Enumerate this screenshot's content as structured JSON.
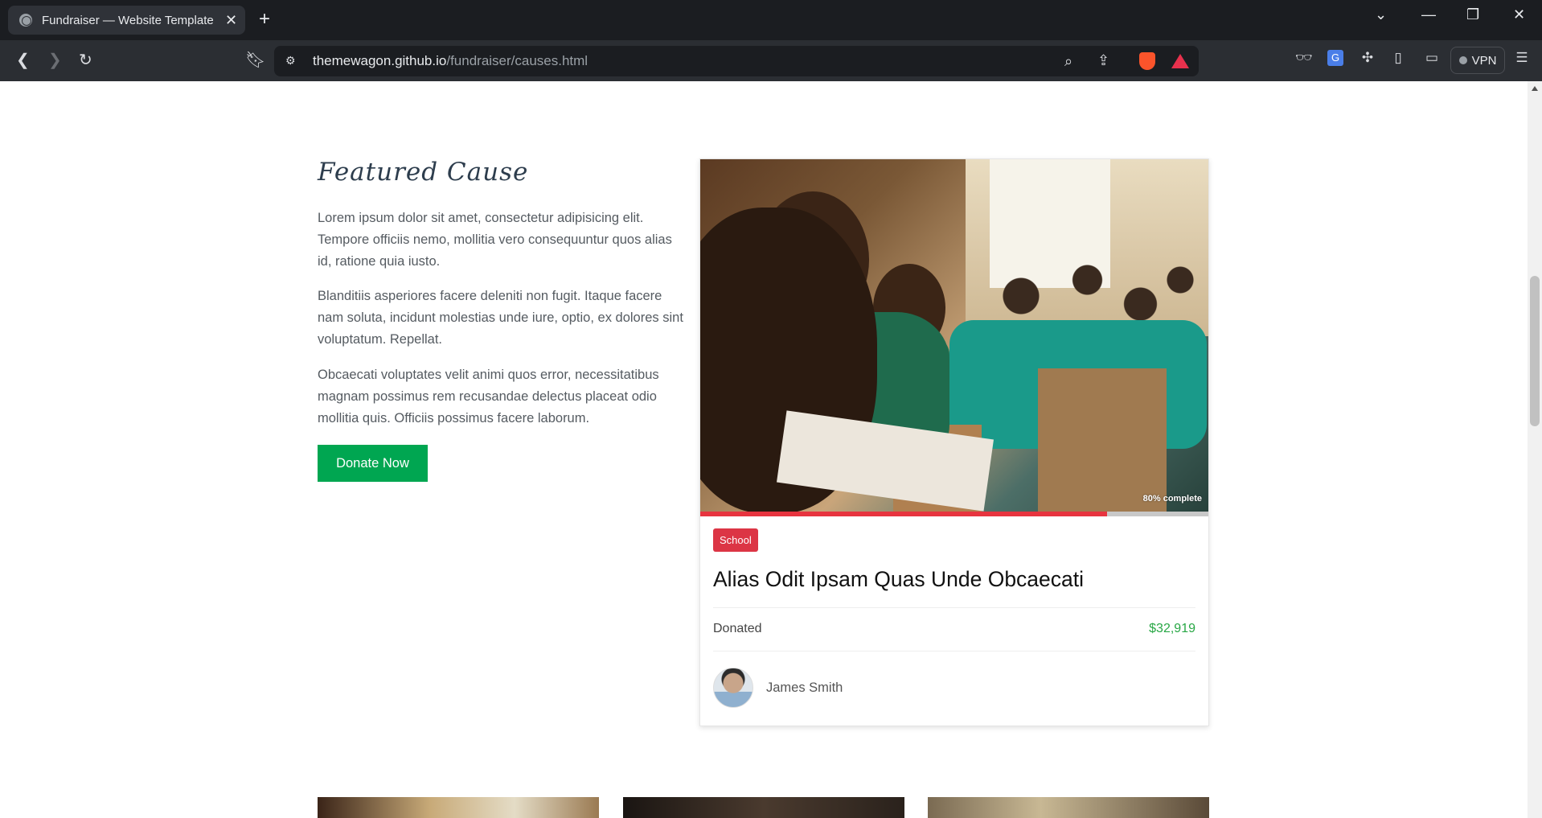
{
  "browser": {
    "tab_title": "Fundraiser — Website Template",
    "url_host": "themewagon.github.io",
    "url_path": "/fundraiser/causes.html",
    "vpn_label": "VPN",
    "new_tab": "+",
    "tab_close": "✕"
  },
  "featured": {
    "title": "Featured Cause",
    "paragraphs": [
      "Lorem ipsum dolor sit amet, consectetur adipisicing elit. Tempore officiis nemo, mollitia vero consequuntur quos alias id, ratione quia iusto.",
      "Blanditiis asperiores facere deleniti non fugit. Itaque facere nam soluta, incidunt molestias unde iure, optio, ex dolores sint voluptatum. Repellat.",
      "Obcaecati voluptates velit animi quos error, necessitatibus magnam possimus rem recusandae delectus placeat odio mollitia quis. Officiis possimus facere laborum."
    ],
    "donate_button": "Donate Now"
  },
  "cause_card": {
    "progress_label": "80% complete",
    "progress_fraction": 0.8,
    "tag": "School",
    "title": "Alias Odit Ipsam Quas Unde Obcaecati",
    "donated_label": "Donated",
    "donated_amount": "$32,919",
    "author": "James Smith"
  },
  "colors": {
    "accent_green": "#00a651",
    "tag_red": "#dc3545",
    "progress_red": "#e7343f",
    "amount_green": "#28a745"
  }
}
